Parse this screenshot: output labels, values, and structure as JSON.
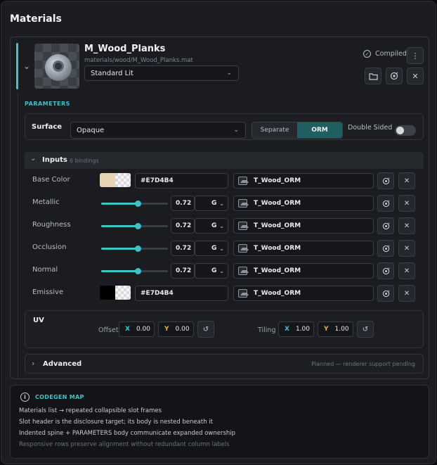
{
  "panel": {
    "title": "Materials"
  },
  "slot": {
    "name": "M_Wood_Planks",
    "path": "materials/wood/M_Wood_Planks.mat",
    "shader": "Standard Lit",
    "status": "Compiled",
    "icons": {
      "expand": "chevron-down-icon",
      "more": "more-vertical-icon",
      "folder": "folder-open-icon",
      "target": "target-icon",
      "close": "close-icon",
      "status": "check-circle-icon"
    }
  },
  "params": {
    "section_label": "PARAMETERS",
    "surface": {
      "label": "Surface",
      "value": "Opaque",
      "separate_label": "Separate",
      "orm_label": "ORM",
      "double_sided_label": "Double Sided",
      "double_sided": false,
      "active_mode": "ORM"
    },
    "inputs": {
      "title": "Inputs",
      "count": "6 bindings",
      "rows": [
        {
          "label": "Base Color",
          "kind": "color",
          "color": "#E7D4B4",
          "hex": "#E7D4B4",
          "texture": "T_Wood_ORM"
        },
        {
          "label": "Metallic",
          "kind": "scalar",
          "fraction": 0.55,
          "value": "0.72",
          "channel": "G",
          "texture": "T_Wood_ORM"
        },
        {
          "label": "Roughness",
          "kind": "scalar",
          "fraction": 0.55,
          "value": "0.72",
          "channel": "G",
          "texture": "T_Wood_ORM"
        },
        {
          "label": "Occlusion",
          "kind": "scalar",
          "fraction": 0.55,
          "value": "0.72",
          "channel": "G",
          "texture": "T_Wood_ORM"
        },
        {
          "label": "Normal",
          "kind": "scalar",
          "fraction": 0.55,
          "value": "0.72",
          "channel": "G",
          "texture": "T_Wood_ORM"
        },
        {
          "label": "Emissive",
          "kind": "color",
          "color": "#000000",
          "hex": "#E7D4B4",
          "texture": "T_Wood_ORM"
        }
      ]
    },
    "uv": {
      "title": "UV",
      "offset_label": "Offset",
      "offset": {
        "x_label": "X",
        "x": "0.00",
        "y_label": "Y",
        "y": "0.00"
      },
      "tiling_label": "Tiling",
      "tiling": {
        "x_label": "X",
        "x": "1.00",
        "y_label": "Y",
        "y": "1.00"
      }
    },
    "advanced": {
      "title": "Advanced",
      "note": "Planned — renderer support pending"
    }
  },
  "codegen": {
    "title": "CODEGEN MAP",
    "lines": [
      "Materials list → repeated collapsible slot frames",
      "Slot header is the disclosure target; its body is nested beneath it",
      "Indented spine + PARAMETERS body communicate expanded ownership",
      "Responsive rows preserve alignment without redundant column labels"
    ]
  },
  "colors": {
    "accent": "#3cc4c8",
    "y_axis": "#e0b243",
    "panel_bg": "#1b1d21"
  }
}
